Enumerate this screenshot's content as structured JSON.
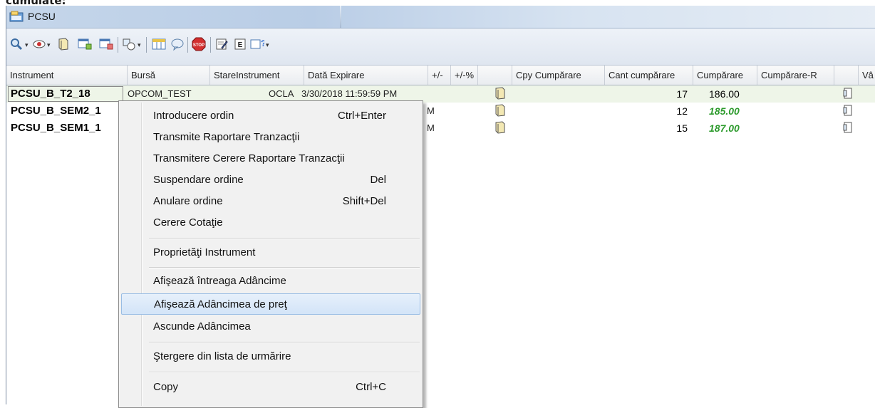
{
  "top_fragment": "cumulate:",
  "window": {
    "title": "PCSU"
  },
  "toolbar": {
    "icons": [
      "magnifier-icon",
      "eye-icon",
      "book-icon",
      "table-link-icon",
      "table-add-icon",
      "shapes-icon",
      "columns-icon",
      "bubble-icon",
      "stop-icon",
      "edit-icon",
      "e-icon",
      "help-icon"
    ]
  },
  "grid": {
    "columns": [
      "Instrument",
      "Bursă",
      "StareInstrument",
      "Dată Expirare",
      "+/-",
      "+/-%",
      "",
      "Cpy Cumpărare",
      "Cant cumpărare",
      "Cumpărare",
      "Cumpărare-R",
      "",
      "Vâ"
    ],
    "rows": [
      {
        "instrument": "PCSU_B_T2_18",
        "bursa_fragment": "OPCOM_TEST",
        "stare_fragment": "OCLA",
        "expiry_fragment": "3/30/2018 11:59:59 PM",
        "qty": "17",
        "price": "186.00",
        "price_style": "normal"
      },
      {
        "instrument": "PCSU_B_SEM2_1",
        "expiry_fragment": "M",
        "qty": "12",
        "price": "185.00",
        "price_style": "green"
      },
      {
        "instrument": "PCSU_B_SEM1_1",
        "expiry_fragment": "M",
        "qty": "15",
        "price": "187.00",
        "price_style": "green"
      }
    ]
  },
  "context_menu": {
    "items": [
      {
        "label": "Introducere ordin",
        "shortcut": "Ctrl+Enter"
      },
      {
        "label": "Transmite Raportare Tranzacţii",
        "shortcut": ""
      },
      {
        "label": "Transmitere Cerere Raportare Tranzacţii",
        "shortcut": ""
      },
      {
        "label": "Suspendare ordine",
        "shortcut": "Del"
      },
      {
        "label": "Anulare ordine",
        "shortcut": "Shift+Del"
      },
      {
        "label": "Cerere Cotaţie",
        "shortcut": ""
      },
      {
        "label": "Proprietăţi Instrument",
        "shortcut": ""
      },
      {
        "label": "Afişează întreaga Adâncime",
        "shortcut": ""
      },
      {
        "label": "Afişează Adâncimea de preţ",
        "shortcut": ""
      },
      {
        "label": "Ascunde Adâncimea",
        "shortcut": ""
      },
      {
        "label": "Ştergere din lista de urmărire",
        "shortcut": ""
      },
      {
        "label": "Copy",
        "shortcut": "Ctrl+C"
      }
    ],
    "highlighted_index": 8
  },
  "colors": {
    "accent_highlight": "#d3e4f8",
    "price_green": "#2e9b2e",
    "selected_row": "#eef5e8"
  }
}
